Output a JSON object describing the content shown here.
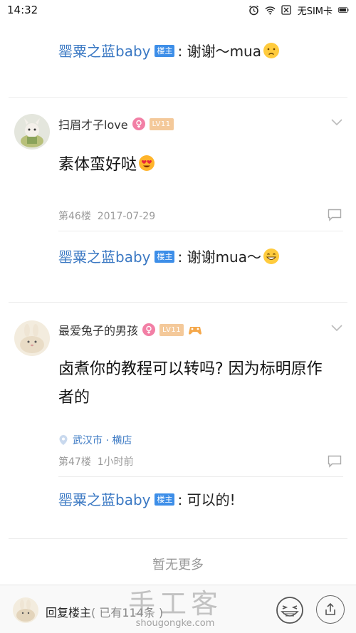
{
  "status_bar": {
    "time": "14:32",
    "carrier": "无SIM卡"
  },
  "host_name": "罂粟之蓝baby",
  "host_badge": "楼主",
  "top_reply": {
    "text": ": 谢谢～mua"
  },
  "posts": [
    {
      "username": "扫眉才子love",
      "level": "LV11",
      "content": "素体蛮好哒",
      "floor": "第46楼",
      "date": "2017-07-29",
      "reply_text": ": 谢谢mua～"
    },
    {
      "username": "最爱兔子的男孩",
      "level": "LV11",
      "content": "卤煮你的教程可以转吗? 因为标明原作者的",
      "location": "武汉市 · 横店",
      "floor": "第47楼",
      "date": "1小时前",
      "reply_text": ": 可以的!"
    }
  ],
  "no_more": "暂无更多",
  "bottom_bar": {
    "reply_label": "回复楼主",
    "count_label": "( 已有114条 )"
  },
  "watermark": {
    "cn": "手工客",
    "en": "shougongke.com"
  },
  "colors": {
    "link": "#3a78c3",
    "badge": "#3d8ee8",
    "gender": "#f27fa5",
    "level": "#f4c99a"
  }
}
